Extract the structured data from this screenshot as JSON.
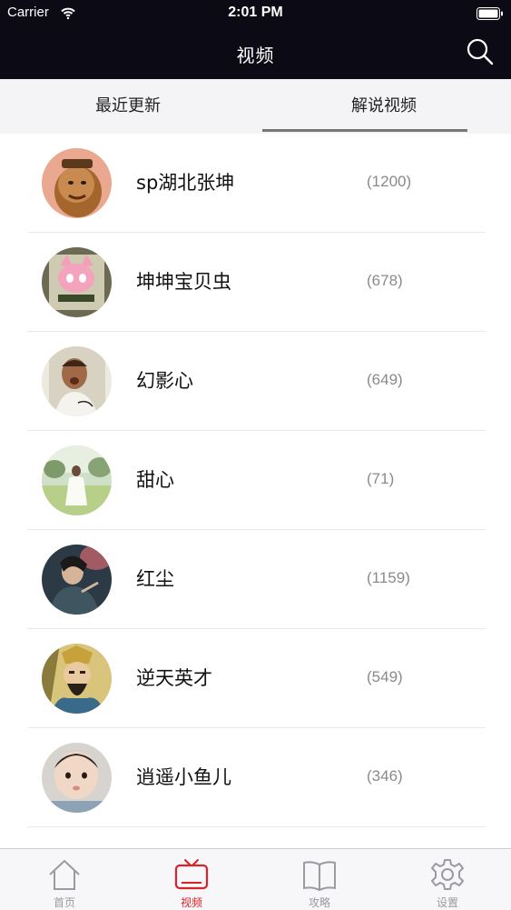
{
  "status_bar": {
    "carrier": "Carrier",
    "time": "2:01 PM"
  },
  "nav": {
    "title": "视频"
  },
  "tabs": [
    {
      "label": "最近更新",
      "selected": false
    },
    {
      "label": "解说视频",
      "selected": true
    }
  ],
  "list": [
    {
      "name": "sp湖北张坤",
      "count": "(1200)"
    },
    {
      "name": "坤坤宝贝虫",
      "count": "(678)"
    },
    {
      "name": "幻影心",
      "count": "(649)"
    },
    {
      "name": "甜心",
      "count": "(71)"
    },
    {
      "name": "红尘",
      "count": "(1159)"
    },
    {
      "name": "逆天英才",
      "count": "(549)"
    },
    {
      "name": "逍遥小鱼儿",
      "count": "(346)"
    }
  ],
  "tabbar": [
    {
      "label": "首页",
      "icon": "home-icon",
      "active": false
    },
    {
      "label": "视频",
      "icon": "tv-icon",
      "active": true
    },
    {
      "label": "攻略",
      "icon": "book-icon",
      "active": false
    },
    {
      "label": "设置",
      "icon": "gear-icon",
      "active": false
    }
  ],
  "colors": {
    "nav_background": "#0c0a14",
    "accent": "#d8232a",
    "muted": "#9a9aa0"
  }
}
